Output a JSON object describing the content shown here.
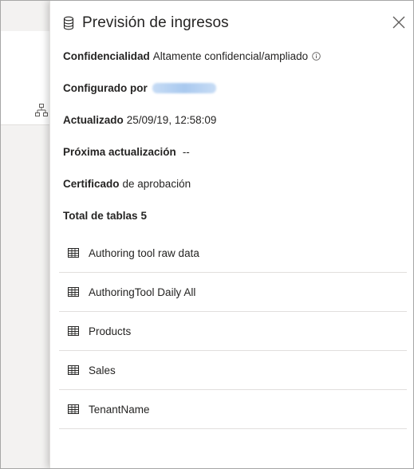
{
  "panel": {
    "title": "Previsión de ingresos",
    "close_icon": "close-icon",
    "dataset_icon": "database-icon"
  },
  "details": {
    "confidentiality_label": "Confidencialidad",
    "confidentiality_value": "Altamente confidencial/ampliado",
    "configured_by_label": "Configurado por",
    "updated_label": "Actualizado",
    "updated_value": "25/09/19, 12:58:09",
    "next_refresh_label": "Próxima actualización",
    "next_refresh_value": "--",
    "certified_label": "Certificado",
    "certified_value": "de aprobación",
    "total_tables_label": "Total de tablas",
    "total_tables_value": "5"
  },
  "tables": [
    {
      "name": "Authoring tool raw data",
      "icon": "table-icon"
    },
    {
      "name": "AuthoringTool Daily All",
      "icon": "table-icon"
    },
    {
      "name": "Products",
      "icon": "table-icon"
    },
    {
      "name": "Sales",
      "icon": "table-icon"
    },
    {
      "name": "TenantName",
      "icon": "table-icon"
    }
  ],
  "colors": {
    "text": "#252423",
    "divider": "#e1dfdd",
    "background_gray": "#f3f2f1",
    "blurred_link": "#a9c9ef"
  }
}
